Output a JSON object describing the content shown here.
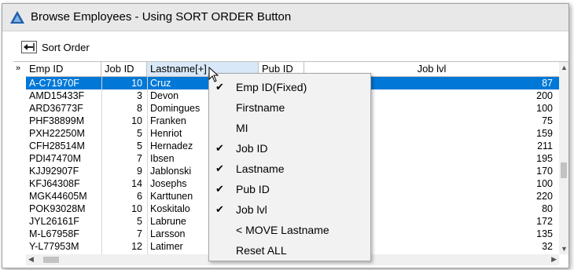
{
  "window": {
    "title": "Browse Employees - Using SORT ORDER Button"
  },
  "toolbar": {
    "sort_label": "Sort Order",
    "sort_icon": "arrow-left-icon"
  },
  "grid": {
    "row_indicator": "»",
    "columns": [
      "Emp ID",
      "Job ID",
      "Lastname[+]",
      "Pub ID",
      "Job lvl"
    ],
    "rows": [
      {
        "emp_id": "A-C71970F",
        "job_id": "10",
        "lastname": "Cruz",
        "job_lvl": "87"
      },
      {
        "emp_id": "AMD15433F",
        "job_id": "3",
        "lastname": "Devon",
        "job_lvl": "200"
      },
      {
        "emp_id": "ARD36773F",
        "job_id": "8",
        "lastname": "Domingues",
        "job_lvl": "100"
      },
      {
        "emp_id": "PHF38899M",
        "job_id": "10",
        "lastname": "Franken",
        "job_lvl": "75"
      },
      {
        "emp_id": "PXH22250M",
        "job_id": "5",
        "lastname": "Henriot",
        "job_lvl": "159"
      },
      {
        "emp_id": "CFH28514M",
        "job_id": "5",
        "lastname": "Hernadez",
        "job_lvl": "211"
      },
      {
        "emp_id": "PDI47470M",
        "job_id": "7",
        "lastname": "Ibsen",
        "job_lvl": "195"
      },
      {
        "emp_id": "KJJ92907F",
        "job_id": "9",
        "lastname": "Jablonski",
        "job_lvl": "170"
      },
      {
        "emp_id": "KFJ64308F",
        "job_id": "14",
        "lastname": "Josephs",
        "job_lvl": "100"
      },
      {
        "emp_id": "MGK44605M",
        "job_id": "6",
        "lastname": "Karttunen",
        "job_lvl": "220"
      },
      {
        "emp_id": "POK93028M",
        "job_id": "10",
        "lastname": "Koskitalo",
        "job_lvl": "80"
      },
      {
        "emp_id": "JYL26161F",
        "job_id": "5",
        "lastname": "Labrune",
        "job_lvl": "172"
      },
      {
        "emp_id": "M-L67958F",
        "job_id": "7",
        "lastname": "Larsson",
        "job_lvl": "135"
      },
      {
        "emp_id": "Y-L77953M",
        "job_id": "12",
        "lastname": "Latimer",
        "job_lvl": "32"
      }
    ],
    "selected_row": 0
  },
  "context_menu": {
    "items": [
      {
        "label": "Emp ID(Fixed)",
        "checked": true
      },
      {
        "label": "Firstname",
        "checked": false
      },
      {
        "label": "MI",
        "checked": false
      },
      {
        "label": "Job ID",
        "checked": true
      },
      {
        "label": "Lastname",
        "checked": true
      },
      {
        "label": "Pub ID",
        "checked": true
      },
      {
        "label": "Job lvl",
        "checked": true
      },
      {
        "label": "< MOVE Lastname",
        "checked": false
      },
      {
        "label": "Reset ALL",
        "checked": false
      }
    ],
    "check_glyph": "✔"
  },
  "colors": {
    "selection": "#0078d7",
    "header_hover": "#d8e8f8",
    "menu_bg": "#f2f2f2"
  }
}
